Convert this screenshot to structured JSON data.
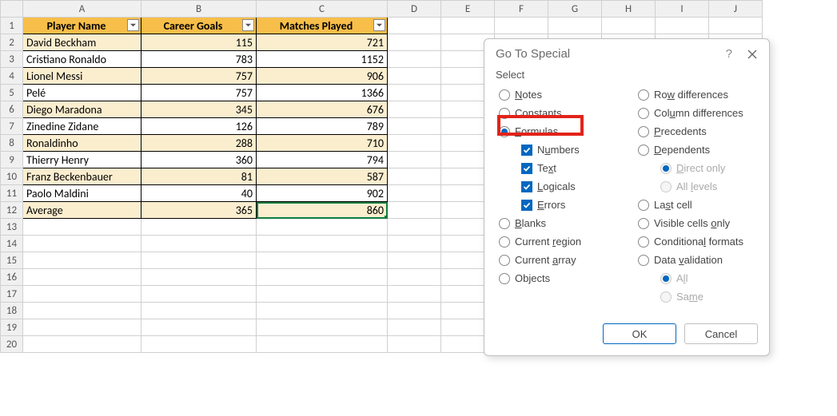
{
  "columns": [
    "A",
    "B",
    "C",
    "D",
    "E",
    "F",
    "G",
    "H",
    "I",
    "J"
  ],
  "rows": [
    "1",
    "2",
    "3",
    "4",
    "5",
    "6",
    "7",
    "8",
    "9",
    "10",
    "11",
    "12",
    "13",
    "14",
    "15",
    "16",
    "17",
    "18",
    "19",
    "20"
  ],
  "headers": {
    "A": "Player Name",
    "B": "Career Goals",
    "C": "Matches Played"
  },
  "data": [
    {
      "A": "David Beckham",
      "B": "115",
      "C": "721",
      "band": true
    },
    {
      "A": "Cristiano Ronaldo",
      "B": "783",
      "C": "1152",
      "band": false
    },
    {
      "A": "Lionel Messi",
      "B": "757",
      "C": "906",
      "band": true
    },
    {
      "A": "Pelé",
      "B": "757",
      "C": "1366",
      "band": false
    },
    {
      "A": "Diego Maradona",
      "B": "345",
      "C": "676",
      "band": true
    },
    {
      "A": "Zinedine Zidane",
      "B": "126",
      "C": "789",
      "band": false
    },
    {
      "A": "Ronaldinho",
      "B": "288",
      "C": "710",
      "band": true
    },
    {
      "A": "Thierry Henry",
      "B": "360",
      "C": "794",
      "band": false
    },
    {
      "A": "Franz Beckenbauer",
      "B": "81",
      "C": "587",
      "band": true
    },
    {
      "A": "Paolo Maldini",
      "B": "40",
      "C": "902",
      "band": false
    },
    {
      "A": "Average",
      "B": "365",
      "C": "860",
      "band": true
    }
  ],
  "dialog": {
    "title": "Go To Special",
    "section": "Select",
    "left": [
      {
        "type": "radio",
        "label": "Notes",
        "u": 0,
        "checked": false
      },
      {
        "type": "radio",
        "label": "Constants",
        "u": 1,
        "checked": false
      },
      {
        "type": "radio",
        "label": "Formulas",
        "u": 0,
        "checked": true
      },
      {
        "type": "check",
        "label": "Numbers",
        "u": 1,
        "checked": true,
        "indent": true
      },
      {
        "type": "check",
        "label": "Text",
        "u": 2,
        "checked": true,
        "indent": true
      },
      {
        "type": "check",
        "label": "Logicals",
        "u": 0,
        "checked": true,
        "indent": true
      },
      {
        "type": "check",
        "label": "Errors",
        "u": 0,
        "checked": true,
        "indent": true
      },
      {
        "type": "radio",
        "label": "Blanks",
        "u": 0,
        "checked": false
      },
      {
        "type": "radio",
        "label": "Current region",
        "u": 8,
        "checked": false
      },
      {
        "type": "radio",
        "label": "Current array",
        "u": 8,
        "checked": false
      },
      {
        "type": "radio",
        "label": "Objects",
        "u": 2,
        "checked": false
      }
    ],
    "right": [
      {
        "type": "radio",
        "label": "Row differences",
        "u": 2,
        "checked": false
      },
      {
        "type": "radio",
        "label": "Column differences",
        "u": 3,
        "checked": false
      },
      {
        "type": "radio",
        "label": "Precedents",
        "u": 0,
        "checked": false
      },
      {
        "type": "radio",
        "label": "Dependents",
        "u": 0,
        "checked": false
      },
      {
        "type": "radio",
        "label": "Direct only",
        "u": 0,
        "checked": true,
        "disabled": true,
        "indent": true
      },
      {
        "type": "radio",
        "label": "All levels",
        "u": 4,
        "checked": false,
        "disabled": true,
        "indent": true
      },
      {
        "type": "radio",
        "label": "Last cell",
        "u": 2,
        "checked": false
      },
      {
        "type": "radio",
        "label": "Visible cells only",
        "u": 14,
        "checked": false
      },
      {
        "type": "radio",
        "label": "Conditional formats",
        "u": 10,
        "checked": false
      },
      {
        "type": "radio",
        "label": "Data validation",
        "u": 5,
        "checked": false
      },
      {
        "type": "radio",
        "label": "All",
        "u": 1,
        "checked": true,
        "disabled": true,
        "indent": true
      },
      {
        "type": "radio",
        "label": "Same",
        "u": 2,
        "checked": false,
        "disabled": true,
        "indent": true
      }
    ],
    "ok": "OK",
    "cancel": "Cancel"
  }
}
